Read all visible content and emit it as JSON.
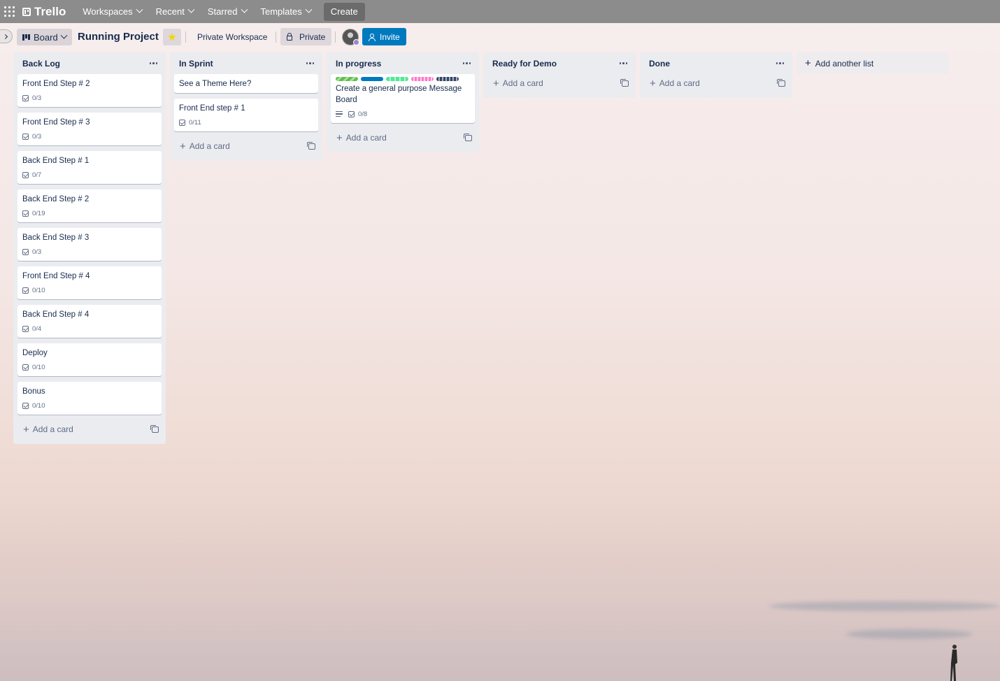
{
  "topbar": {
    "logo": "Trello",
    "nav": [
      "Workspaces",
      "Recent",
      "Starred",
      "Templates"
    ],
    "create": "Create"
  },
  "board": {
    "view": "Board",
    "title": "Running Project",
    "workspace": "Private Workspace",
    "visibility": "Private",
    "invite": "Invite"
  },
  "label_colors": [
    "#61bd4f",
    "#0079bf",
    "#51e898",
    "#ff78cb",
    "#344563"
  ],
  "lists": [
    {
      "title": "Back Log",
      "cards": [
        {
          "title": "Front End Step # 2",
          "checklist": "0/3"
        },
        {
          "title": "Front End Step # 3",
          "checklist": "0/3"
        },
        {
          "title": "Back End Step # 1",
          "checklist": "0/7"
        },
        {
          "title": "Back End Step # 2",
          "checklist": "0/19"
        },
        {
          "title": "Back End Step # 3",
          "checklist": "0/3"
        },
        {
          "title": "Front End Step # 4",
          "checklist": "0/10"
        },
        {
          "title": "Back End Step # 4",
          "checklist": "0/4"
        },
        {
          "title": "Deploy",
          "checklist": "0/10"
        },
        {
          "title": "Bonus",
          "checklist": "0/10"
        }
      ]
    },
    {
      "title": "In Sprint",
      "cards": [
        {
          "title": "See a Theme Here?"
        },
        {
          "title": "Front End step # 1",
          "checklist": "0/11"
        }
      ]
    },
    {
      "title": "In progress",
      "cards": [
        {
          "title": "Create a general purpose Message Board",
          "checklist": "0/8",
          "labels": true,
          "description": true
        }
      ]
    },
    {
      "title": "Ready for Demo",
      "cards": []
    },
    {
      "title": "Done",
      "cards": []
    }
  ],
  "add_card": "Add a card",
  "add_list": "Add another list"
}
